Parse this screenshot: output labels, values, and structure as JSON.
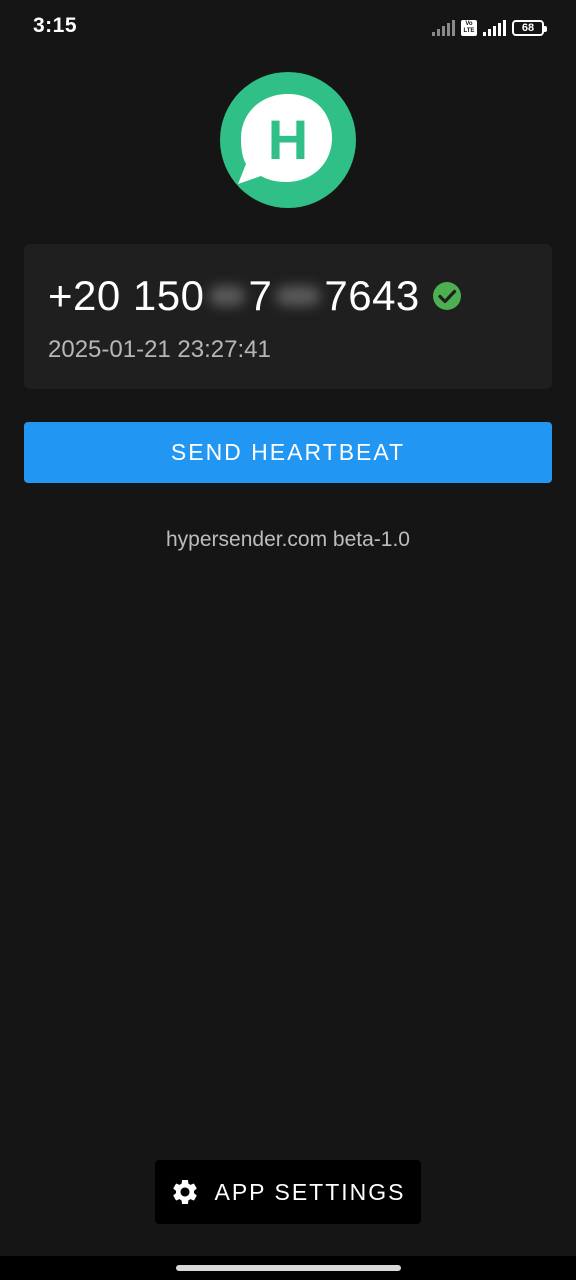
{
  "status_bar": {
    "time": "3:15",
    "volte_label": "Vo LTE",
    "battery_level": "68"
  },
  "logo": {
    "letter": "H",
    "brand_color": "#2fbf87"
  },
  "account": {
    "phone_part1": "+20 150",
    "phone_part2": "7",
    "phone_part3": "7643",
    "verified_icon": "check-circle-icon",
    "verified_color": "#4caf50",
    "last_seen": "2025-01-21 23:27:41"
  },
  "actions": {
    "send_heartbeat_label": "SEND HEARTBEAT",
    "primary_color": "#2196f3"
  },
  "footer": {
    "version_text": "hypersender.com beta-1.0"
  },
  "settings": {
    "label": "APP SETTINGS",
    "icon": "gear-icon"
  }
}
